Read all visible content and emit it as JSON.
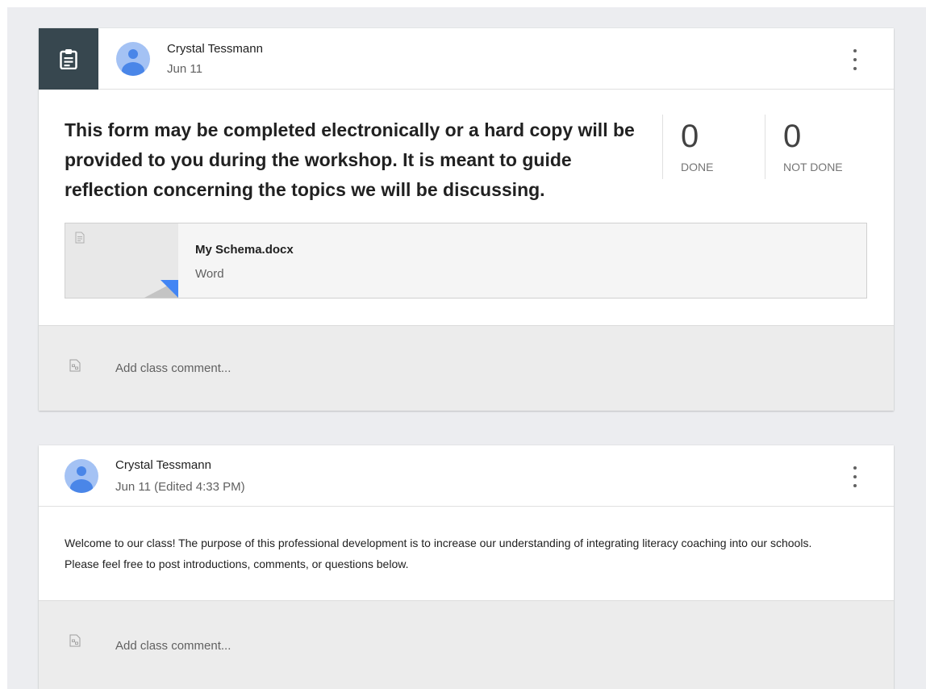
{
  "assignment_post": {
    "icon": "assignment-icon",
    "author": "Crystal Tessmann",
    "date": "Jun 11",
    "title": "This form may be completed electronically or a hard copy will be provided to you during the workshop. It is meant to guide reflection concerning the topics we will be discussing.",
    "stats": {
      "done_count": "0",
      "done_label": "DONE",
      "not_done_count": "0",
      "not_done_label": "NOT DONE"
    },
    "attachment": {
      "name": "My Schema.docx",
      "type": "Word",
      "icon": "document-icon"
    },
    "comment_placeholder": "Add class comment..."
  },
  "announcement_post": {
    "author": "Crystal Tessmann",
    "date": "Jun 11 (Edited 4:33 PM)",
    "body": "Welcome to our class! The purpose of this professional development is to increase our understanding of integrating literacy coaching into our schools. Please feel free to post introductions, comments, or questions below.",
    "comment_placeholder": "Add class comment..."
  },
  "colors": {
    "page_background": "#ecedf0",
    "badge_background": "#37474f",
    "avatar": "#a4c2f4",
    "avatar_figure": "#4a86e8",
    "attachment_accent": "#4285f4"
  }
}
